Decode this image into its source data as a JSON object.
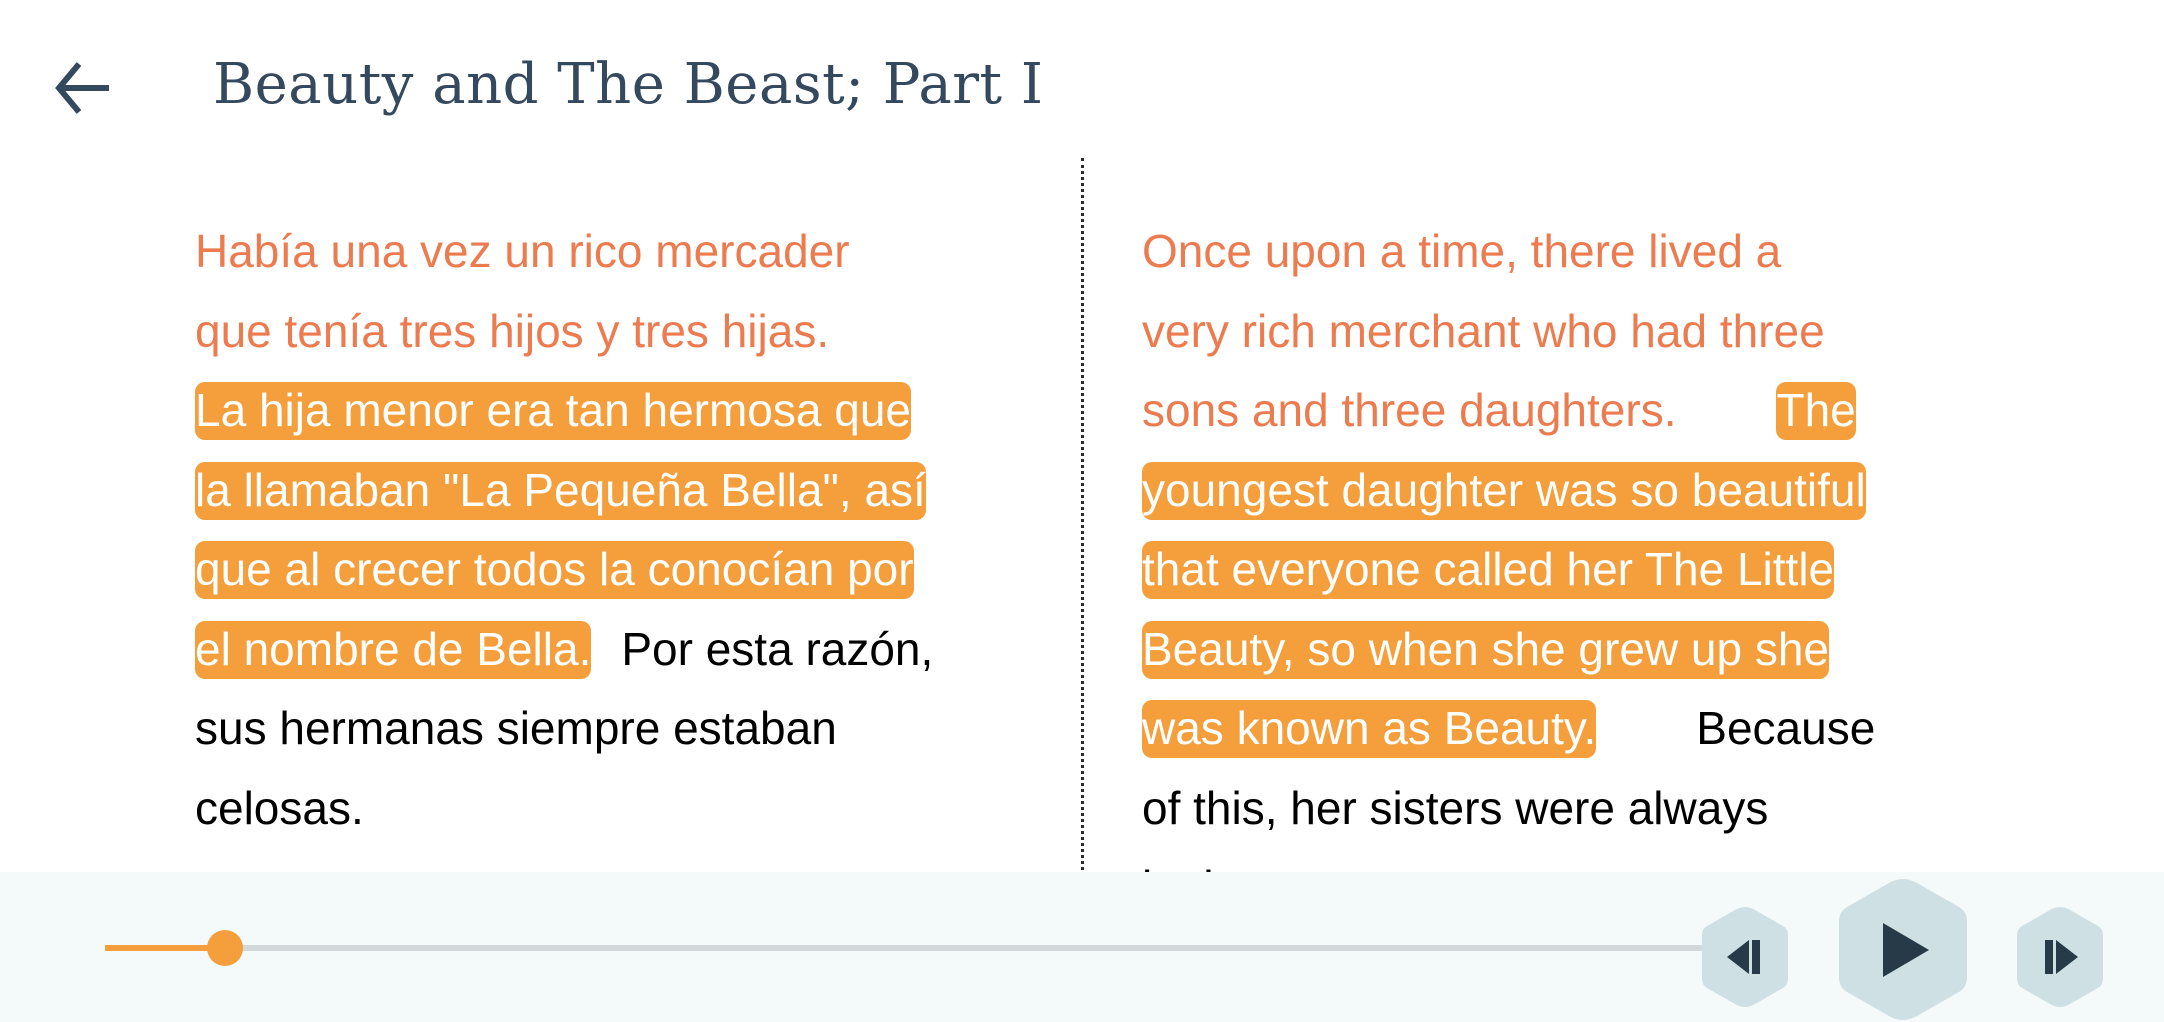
{
  "header": {
    "title": "Beauty and The Beast; Part I",
    "back_icon": "arrow-left-icon"
  },
  "colors": {
    "accent": "#f59e3c",
    "read_text": "#ec7b4f",
    "title": "#34495e",
    "player_bg": "#f4f9fa",
    "control_bg": "#cfe0e5",
    "control_icon": "#263b47"
  },
  "spanish": {
    "lines": [
      {
        "read": "Había una vez un rico mercader"
      },
      {
        "read": "que tenía tres hijos y tres hijas."
      },
      {
        "highlight": "La hija menor era tan hermosa que"
      },
      {
        "highlight": "la llamaban \"La Pequeña Bella\", así"
      },
      {
        "highlight": "que al crecer todos la conocían por"
      },
      {
        "highlight": "el nombre de Bella.",
        "plain": "Por esta razón,"
      },
      {
        "plain": "sus hermanas siempre estaban"
      },
      {
        "plain": "celosas."
      }
    ]
  },
  "english": {
    "lines": [
      {
        "read": "Once upon a time, there lived a"
      },
      {
        "read": "very rich merchant who had three"
      },
      {
        "read": "sons and three daughters.",
        "highlight": "The"
      },
      {
        "highlight": "youngest daughter was so beautiful"
      },
      {
        "highlight": "that everyone called her The Little"
      },
      {
        "highlight": "Beauty, so when she grew up she"
      },
      {
        "highlight": "was known as Beauty.",
        "plain": "Because"
      },
      {
        "plain": "of this, her sisters were always"
      },
      {
        "plain": "jealous."
      }
    ]
  },
  "player": {
    "progress": 0.075,
    "prev_icon": "skip-previous-sentence-icon",
    "play_icon": "play-icon",
    "next_icon": "skip-next-sentence-icon"
  }
}
